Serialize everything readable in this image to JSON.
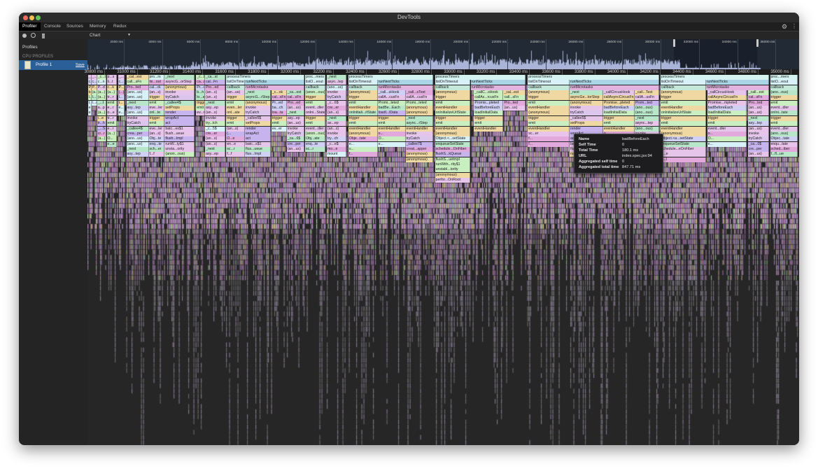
{
  "window": {
    "title": "DevTools",
    "lights": [
      "#ec6a5e",
      "#f4bf4f",
      "#61c554"
    ]
  },
  "tabs": [
    {
      "label": "Profiler",
      "selected": true
    },
    {
      "label": "Console"
    },
    {
      "label": "Sources"
    },
    {
      "label": "Memory"
    },
    {
      "label": "Redux"
    }
  ],
  "toolbar": {
    "view_select": "Chart",
    "icons": [
      "record-icon",
      "clear-icon",
      "trash-icon",
      "gear-icon",
      "kebab-menu-icon"
    ]
  },
  "sidebar": {
    "title": "Profiles",
    "section": "CPU PROFILES",
    "profile": {
      "label": "Profile 1",
      "save": "Save"
    }
  },
  "overview": {
    "ticks": [
      "2000 ms",
      "4000 ms",
      "6000 ms",
      "8000 ms",
      "10000 ms",
      "12000 ms",
      "14000 ms",
      "16000 ms",
      "18000 ms",
      "20000 ms",
      "22000 ms",
      "24000 ms",
      "26000 ms",
      "28000 ms",
      "30000 ms",
      "32000 ms",
      "34000 ms",
      "36000 ms"
    ],
    "tick_values": [
      2000,
      4000,
      6000,
      8000,
      10000,
      12000,
      14000,
      16000,
      18000,
      20000,
      22000,
      24000,
      26000,
      28000,
      30000,
      32000,
      34000,
      36000
    ],
    "selection_ms": [
      30700,
      35046
    ],
    "histogram_color": "#aab4d8"
  },
  "ruler": {
    "ticks": [
      "30800 ms",
      "31000 ms",
      "31200 ms",
      "31400 ms",
      "31600 ms",
      "31800 ms",
      "32000 ms",
      "32200 ms",
      "32400 ms",
      "32600 ms",
      "32800 ms",
      "33000 ms",
      "33200 ms",
      "33400 ms",
      "33600 ms",
      "33800 ms",
      "34000 ms",
      "34200 ms",
      "34400 ms",
      "34600 ms",
      "34800 ms",
      "35000 ms",
      "35200 ms"
    ],
    "tick_values": [
      30800,
      31000,
      31200,
      31400,
      31600,
      31800,
      32000,
      32200,
      32400,
      32600,
      32800,
      33000,
      33200,
      33400,
      33600,
      33800,
      34000,
      34200,
      34400,
      34600,
      34800,
      35000,
      35200
    ]
  },
  "colors": {
    "processTimers": "#d4f3f1",
    "proc...mers": "#d4f3f1",
    "pro...rs": "#d4f3f1",
    "listOnTimeout": "#d8f1f8",
    "runNextTicks": "#a9d5e6",
    "callback": "#c4e8da",
    "runMicrotasks": "#e2b3de",
    "(anonymous)": "#efd8a2",
    "trigger": "#efd8a2",
    "emit": "#c9eec0",
    "eventHandler": "#efd8a2",
    "_next": "#b8e6c8",
    "invoke": "#e6c5ea",
    "tryCatch": "#ddc6ee",
    "badBeforeEach": "#cfd0f4",
    "loadInitialData": "#c9eec0",
    "onInitializeUrlState": "#c9eec0",
    "render": "#c7b3ee",
    "wrapAct": "#c7b3ee",
    "act": "#c7b3ee",
    "setProps": "#efd8a2",
    "palette": [
      "#e8c3ea",
      "#c9eec0",
      "#efd8a2",
      "#cfd0f4",
      "#b8e6c8",
      "#d8f1f8",
      "#e2a9dc",
      "#c7b3ee",
      "#e6c5ea"
    ]
  },
  "frames": [
    {
      "s": 30700,
      "e": 30721,
      "d": 0,
      "stack": [
        "_...",
        "c...",
        "P...",
        "b...",
        "l...a",
        "t...r",
        "e...",
        "e..."
      ]
    },
    {
      "s": 30721,
      "e": 30756,
      "d": 0,
      "stack": [
        "_...",
        "c...",
        "P...",
        "(a...)",
        "I...",
        "t...r"
      ]
    },
    {
      "s": 30756,
      "e": 30815,
      "d": 0,
      "stack": [
        "_c...t",
        "c...n",
        "P...d",
        "(a...)",
        "(a...)",
        "_...t",
        "a...p",
        "(a...)",
        "i...e",
        "tr...h",
        "_...S",
        "cr...r",
        "(a...)"
      ]
    },
    {
      "s": 30815,
      "e": 30875,
      "d": 0,
      "stack": [
        "p...s",
        "li...t",
        "c...k",
        "(a...)",
        "tr...r",
        "emit",
        "e...r",
        "o...e",
        "tr...r",
        "emit",
        "e...r",
        "(a...)",
        "O...",
        "e...e"
      ]
    },
    {
      "s": 30884,
      "e": 30926,
      "d": 0,
      "stack": [
        "_...",
        "c...",
        "P...",
        "(...)",
        "l...",
        "t...",
        "e...",
        "e..."
      ]
    },
    {
      "s": 30935,
      "e": 31072,
      "d": 0,
      "stack": [
        "_cal...est",
        "call...sFn",
        "Pro...ted",
        "(ano...us)",
        "(ano...us)",
        "_next",
        "asy...tep",
        "(ano...us)",
        "invoke",
        "tryCatch",
        "_callee4$",
        "crea...per",
        "(ano...us)",
        "(ano...us)",
        "_next",
        "asy...tep"
      ]
    },
    {
      "s": 31072,
      "e": 31170,
      "d": 0,
      "stack": [
        "pro...rs",
        "lis...out",
        "cal...ck",
        "(an...s)",
        "trigger",
        "emit",
        "eve...ler",
        "onl...te",
        "trigger",
        "emit",
        "eve...ler",
        "(an...s)",
        "Obj...te",
        "enq...te",
        "sch...er",
        "f...f"
      ]
    },
    {
      "s": 31170,
      "e": 31353,
      "d": 0,
      "stack": [
        "_next",
        "asyncG...orStep",
        "(anonymous)",
        "invoke",
        "tryCatch",
        "_callee4$",
        "setProps",
        "render",
        "wrapAct",
        "act",
        "batc...es$1",
        "flush...ueue",
        "flush...Impl",
        "runW...ty$1",
        "unsta...ority",
        "(anon...ous)"
      ]
    },
    {
      "s": 31362,
      "e": 31417,
      "d": 0,
      "stack": [
        "_c...k",
        "ca...n",
        "Pr...d",
        "b...h",
        "lo...a",
        "trigger",
        "emit",
        "ev...r"
      ]
    },
    {
      "s": 31417,
      "e": 31541,
      "d": 0,
      "stack": [
        "_ca...st",
        "cal...Fn",
        "Pro...ed",
        "(an...s)",
        "(an...s)",
        "_next",
        "asy...ep",
        "(an...s)",
        "invoke",
        "try...tch",
        "_c...5$",
        "cre...er",
        "(an...s)",
        "(an...s)",
        "_next",
        "asy...ep"
      ]
    },
    {
      "s": 31546,
      "e": 32025,
      "d": 0,
      "stack": [
        "processTimers"
      ]
    },
    {
      "s": 31546,
      "e": 31661,
      "d": 1,
      "stack": [
        "listOnTimeout",
        "callback",
        "(an...us)",
        "trigger",
        "emit",
        "even...ler",
        "onl...ate",
        "trigger",
        "emit",
        "(an...s)",
        "(...",
        "O...e",
        "en...e",
        "sc...r",
        "f...f"
      ]
    },
    {
      "s": 31661,
      "e": 32025,
      "d": 1,
      "stack": [
        "runNextTicks",
        "runMicrotasks"
      ]
    },
    {
      "s": 31661,
      "e": 31819,
      "d": 3,
      "stack": [
        "_next",
        "asyncG...rStep",
        "(anonymous)",
        "invoke",
        "tryCatch",
        "_callee5$",
        "setProps",
        "render",
        "wrapAct",
        "act",
        "batc...s$1",
        "flus...ueue",
        "flus...Impl"
      ]
    },
    {
      "s": 31823,
      "e": 31917,
      "d": 3,
      "stack": [
        "_c...ok",
        "cal...sFn",
        "Pr...ed",
        "ba...ch",
        "loa...ta",
        "trigger",
        "emit",
        "ev...er"
      ]
    },
    {
      "s": 31917,
      "e": 32025,
      "d": 3,
      "stack": [
        "_ca...est",
        "cal...sFn",
        "Pro...ed",
        "(an...us)",
        "_next",
        "asy...ep",
        "(an...us)",
        "invoke",
        "tryCatch",
        "_ca...6$",
        "cre...per",
        "(an...us)"
      ]
    },
    {
      "s": 32029,
      "e": 32153,
      "d": 0,
      "stack": [
        "proc...mers",
        "listO...eout",
        "callback",
        "(anon...ous)",
        "trigger",
        "emit",
        "event...dler",
        "onIni...State",
        "trigger",
        "emit",
        "event...dler",
        "(anon...ous)",
        "Obj...ate",
        "enq...te",
        "sc...r"
      ]
    },
    {
      "s": 32162,
      "e": 32281,
      "d": 0,
      "stack": [
        "_next",
        "asyn...tep",
        "(ano...us)",
        "invoke",
        "tryCatch",
        "_c...6$",
        "cre...er",
        "(an...s)",
        "_next",
        "as...ep",
        "(an...s)",
        "invoke",
        "try...ch",
        "_c...e$",
        "mo...e",
        "mount"
      ]
    },
    {
      "s": 32294,
      "e": 32815,
      "d": 0,
      "stack": [
        "processTimers"
      ]
    },
    {
      "s": 32294,
      "e": 32473,
      "d": 1,
      "stack": [
        "listOnTimeout",
        "callback",
        "(anonymous)",
        "trigger",
        "emit",
        "eventHandler",
        "onInitiali...rlState",
        "trigger",
        "emit",
        "eventHandler",
        "(anonymous)",
        "Obje...tate",
        "e...",
        "s...",
        "f..."
      ]
    },
    {
      "s": 32473,
      "e": 32815,
      "d": 1,
      "stack": [
        "runNextTicks",
        "runMicrotasks"
      ]
    },
    {
      "s": 32473,
      "e": 32644,
      "d": 3,
      "stack": [
        "_call...sHook",
        "callA...cusFn",
        "Promi...leted",
        "badBe...Each",
        "loadI...lData",
        "trigger",
        "emit",
        "eventHandler",
        "o...",
        "O...",
        "e..."
      ]
    },
    {
      "s": 32644,
      "e": 32815,
      "d": 3,
      "stack": [
        "_call...sTest",
        "callA...cusFn",
        "Promi...leted",
        "(anonymous)",
        "(anonymous)",
        "_next",
        "async...rStep",
        "eventHandler",
        "invoke",
        "tryCatch",
        "_callee7$",
        "creat...apper",
        "(anonymous)",
        "(anonymous)"
      ]
    },
    {
      "s": 32824,
      "e": 33380,
      "d": 0,
      "stack": [
        "processTimers"
      ]
    },
    {
      "s": 32824,
      "e": 33042,
      "d": 1,
      "stack": [
        "listOnTimeout",
        "callback",
        "(anonymous)",
        "trigger",
        "emit",
        "eventHandler",
        "onInitializeUrlState",
        "trigger",
        "emit",
        "eventHandler",
        "(anonymous)",
        "Object.<...setState",
        "enqueueSetState",
        "schedule...OnFiber",
        "flushS...kQueue",
        "flushS...uetmpl",
        "runWith...rity$1",
        "unstabl...iority",
        "(anonymous)",
        "perfor...OnRoot"
      ]
    },
    {
      "s": 33042,
      "e": 33380,
      "d": 1,
      "stack": [
        "runNextTicks",
        "runMicrotasks"
      ]
    },
    {
      "s": 33063,
      "e": 33243,
      "d": 3,
      "stack": [
        "_callC...sHook",
        "callAs...rcusFn",
        "Promis...pleted",
        "badBeforeEach",
        "loadInitialData",
        "trigger",
        "emit",
        "eventHandler"
      ]
    },
    {
      "s": 33243,
      "e": 33380,
      "d": 3,
      "stack": [
        "_cal...est",
        "call...sFn",
        "Pro...ted",
        "(an...us)"
      ]
    },
    {
      "s": 33392,
      "e": 34196,
      "d": 0,
      "stack": [
        "processTimers"
      ]
    },
    {
      "s": 33392,
      "e": 33648,
      "d": 1,
      "stack": [
        "listOnTimeout",
        "callback",
        "(anonymous)",
        "trigger",
        "emit",
        "eventHandler",
        "(anonymous)",
        "trigger",
        "emit",
        "eventHandler",
        "sc...er",
        "f...",
        "f..."
      ]
    },
    {
      "s": 33648,
      "e": 34196,
      "d": 1,
      "stack": [
        "runNextTicks",
        "runMicrotasks"
      ]
    },
    {
      "s": 33648,
      "e": 33853,
      "d": 3,
      "stack": [
        "_next",
        "asyncGe...torStep",
        "(anonymous)",
        "invoke",
        "tryCatch",
        "_callee5$",
        "setProps",
        "render",
        "wrapAct",
        "act",
        "batc...s$1",
        "flush...ueue",
        "runWi...ty$1"
      ]
    },
    {
      "s": 33853,
      "e": 34046,
      "d": 3,
      "stack": [
        "_callCircusHook",
        "callAsyncCircusFn",
        "Promise...pleted",
        "badBeforeEach",
        "loadInitialData",
        "trigger",
        "emit",
        "eventHandler",
        "o...",
        "O...",
        "e..."
      ]
    },
    {
      "s": 34046,
      "e": 34196,
      "d": 3,
      "stack": [
        "_call...Test",
        "callA...usFn",
        "Prom...ted",
        "(ano...ous)",
        "(ano...ous)",
        "_next",
        "async...tep",
        "(ano...ous)",
        "invoke",
        "tryCatch",
        "_callee9$",
        "crea...per",
        "(ano...us)"
      ]
    },
    {
      "s": 34204,
      "e": 34867,
      "d": 0,
      "stack": [
        "processTimers"
      ]
    },
    {
      "s": 34204,
      "e": 34482,
      "d": 1,
      "stack": [
        "listOnTimeout",
        "callback",
        "(anonymous)",
        "trigger",
        "emit",
        "eventHandler",
        "onInitializeUrlState",
        "trigger",
        "emit",
        "eventHandler",
        "(anonymous)",
        "Object.<a...setState",
        "enqueueSetState",
        "schedule...eOnFiber",
        "fl...e",
        "fl...l"
      ]
    },
    {
      "s": 34482,
      "e": 34867,
      "d": 1,
      "stack": [
        "runNextTicks",
        "runMicrotasks"
      ]
    },
    {
      "s": 34490,
      "e": 34730,
      "d": 3,
      "stack": [
        "_callCircusHook",
        "callAsyncCircusFn",
        "Promise...mpleted",
        "badBeforeEach",
        "loadInitialData",
        "trigger",
        "emit",
        "event...dler",
        "o...",
        "O...",
        "e..."
      ]
    },
    {
      "s": 34739,
      "e": 34867,
      "d": 3,
      "stack": [
        "_call...est",
        "cal...sFn",
        "Pro...ted",
        "(an...us)",
        "(an...us)",
        "_next",
        "asy...tep",
        "(an...us)",
        "invoke",
        "tryCatch",
        "_ca...0$",
        "cre...per",
        "(an...us)"
      ]
    },
    {
      "s": 34875,
      "e": 35046,
      "d": 0,
      "stack": [
        "proc...mers",
        "listO...eout",
        "callback",
        "(ano...ous)",
        "trigger",
        "emit",
        "event...dler",
        "onIni...tate",
        "trigger",
        "emit",
        "event...dler",
        "(ano...ous)",
        "Objec...tate",
        "enqu...tate",
        "sched...iber",
        "f...fl...ue"
      ]
    }
  ],
  "tooltip": {
    "rows": [
      {
        "k": "Name",
        "v": "badBeforeEach"
      },
      {
        "k": "Self Time",
        "v": "0"
      },
      {
        "k": "Total Time",
        "v": "180.1 ms"
      },
      {
        "k": "URL",
        "v": "index.spec.jsx:94"
      },
      {
        "k": "Aggregated self time",
        "v": "0"
      },
      {
        "k": "Aggregated total time",
        "v": "847.71 ms"
      }
    ]
  }
}
